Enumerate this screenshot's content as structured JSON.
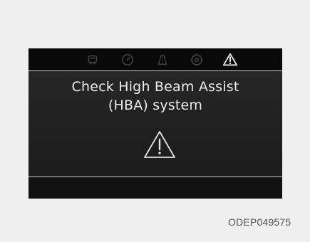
{
  "display": {
    "message_line_1": "Check High Beam Assist",
    "message_line_2": "(HBA) system",
    "status_icons": [
      "vehicle-icon",
      "cruise-gauge-icon",
      "lane-assist-icon",
      "settings-gear-icon",
      "active-warning-icon"
    ],
    "main_icon": "warning-triangle-icon",
    "colors": {
      "panel_background": "#141414",
      "message_text": "#ececec",
      "icon_dim": "#3f3f3f",
      "icon_active": "#f2f2f2"
    }
  },
  "footer": {
    "image_code": "ODEP049575"
  }
}
